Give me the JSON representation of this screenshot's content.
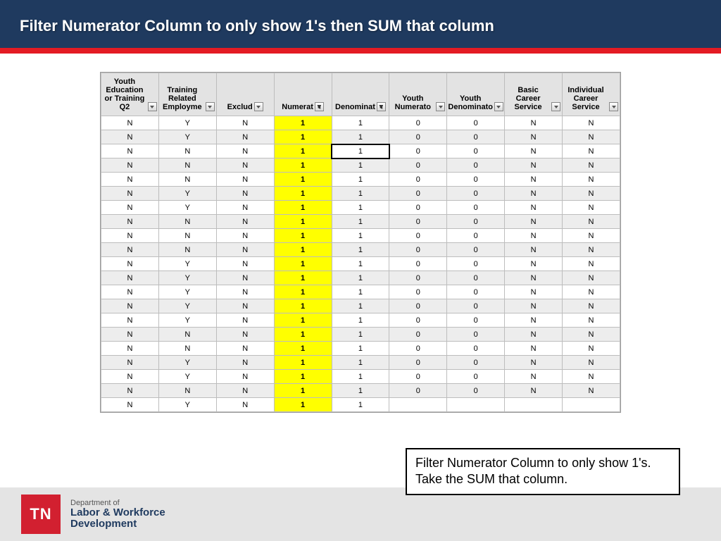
{
  "header": {
    "title": "Filter Numerator Column to only show 1's then SUM that column"
  },
  "columns": [
    {
      "label": "Youth Education or Training Q2",
      "filtered": false
    },
    {
      "label": "Training Related Employme",
      "filtered": false
    },
    {
      "label": "Exclud",
      "filtered": false
    },
    {
      "label": "Numerat",
      "filtered": true,
      "highlight": true
    },
    {
      "label": "Denominat",
      "filtered": true,
      "selected_row": 3
    },
    {
      "label": "Youth Numerato",
      "filtered": false
    },
    {
      "label": "Youth Denominato",
      "filtered": false
    },
    {
      "label": "Basic Career Service",
      "filtered": false
    },
    {
      "label": "Individual Career Service",
      "filtered": false
    }
  ],
  "rows": [
    [
      "N",
      "Y",
      "N",
      "1",
      "1",
      "0",
      "0",
      "N",
      "N"
    ],
    [
      "N",
      "Y",
      "N",
      "1",
      "1",
      "0",
      "0",
      "N",
      "N"
    ],
    [
      "N",
      "N",
      "N",
      "1",
      "1",
      "0",
      "0",
      "N",
      "N"
    ],
    [
      "N",
      "N",
      "N",
      "1",
      "1",
      "0",
      "0",
      "N",
      "N"
    ],
    [
      "N",
      "N",
      "N",
      "1",
      "1",
      "0",
      "0",
      "N",
      "N"
    ],
    [
      "N",
      "Y",
      "N",
      "1",
      "1",
      "0",
      "0",
      "N",
      "N"
    ],
    [
      "N",
      "Y",
      "N",
      "1",
      "1",
      "0",
      "0",
      "N",
      "N"
    ],
    [
      "N",
      "N",
      "N",
      "1",
      "1",
      "0",
      "0",
      "N",
      "N"
    ],
    [
      "N",
      "N",
      "N",
      "1",
      "1",
      "0",
      "0",
      "N",
      "N"
    ],
    [
      "N",
      "N",
      "N",
      "1",
      "1",
      "0",
      "0",
      "N",
      "N"
    ],
    [
      "N",
      "Y",
      "N",
      "1",
      "1",
      "0",
      "0",
      "N",
      "N"
    ],
    [
      "N",
      "Y",
      "N",
      "1",
      "1",
      "0",
      "0",
      "N",
      "N"
    ],
    [
      "N",
      "Y",
      "N",
      "1",
      "1",
      "0",
      "0",
      "N",
      "N"
    ],
    [
      "N",
      "Y",
      "N",
      "1",
      "1",
      "0",
      "0",
      "N",
      "N"
    ],
    [
      "N",
      "Y",
      "N",
      "1",
      "1",
      "0",
      "0",
      "N",
      "N"
    ],
    [
      "N",
      "N",
      "N",
      "1",
      "1",
      "0",
      "0",
      "N",
      "N"
    ],
    [
      "N",
      "N",
      "N",
      "1",
      "1",
      "0",
      "0",
      "N",
      "N"
    ],
    [
      "N",
      "Y",
      "N",
      "1",
      "1",
      "0",
      "0",
      "N",
      "N"
    ],
    [
      "N",
      "Y",
      "N",
      "1",
      "1",
      "0",
      "0",
      "N",
      "N"
    ],
    [
      "N",
      "N",
      "N",
      "1",
      "1",
      "0",
      "0",
      "N",
      "N"
    ],
    [
      "N",
      "Y",
      "N",
      "1",
      "1",
      "",
      "",
      "",
      ""
    ]
  ],
  "callout": {
    "line1": "Filter Numerator Column to only show 1's.",
    "line2": "Take the SUM that column."
  },
  "footer": {
    "badge": "TN",
    "dept_prefix": "Department of",
    "dept_line1": "Labor & Workforce",
    "dept_line2": "Development"
  }
}
